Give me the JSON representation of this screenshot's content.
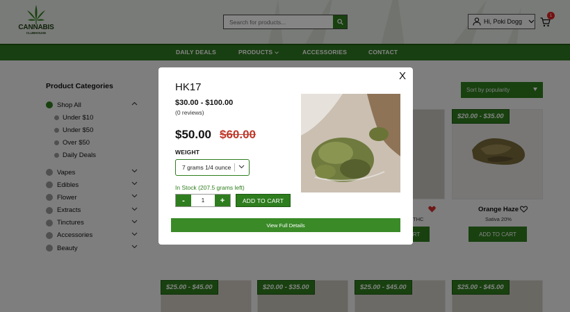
{
  "header": {
    "logo_line1": "CANNABIS",
    "logo_line2": "CLUBHOUSE",
    "search_placeholder": "Search for products...",
    "account_label": "Hi, Poki Dogg",
    "cart_count": "1"
  },
  "nav": {
    "items": [
      "DAILY DEALS",
      "PRODUCTS",
      "ACCESSORIES",
      "CONTACT"
    ]
  },
  "sidebar": {
    "title": "Product Categories",
    "categories": [
      {
        "label": "Shop All"
      },
      {
        "label": "Under $10"
      },
      {
        "label": "Under $50"
      },
      {
        "label": "Over $50"
      },
      {
        "label": "Daily Deals"
      },
      {
        "label": "Vapes"
      },
      {
        "label": "Edibles"
      },
      {
        "label": "Flower"
      },
      {
        "label": "Extracts"
      },
      {
        "label": "Tinctures"
      },
      {
        "label": "Accessories"
      },
      {
        "label": "Beauty"
      }
    ]
  },
  "sort": {
    "label": "Sort by popularity"
  },
  "products": [
    {
      "price": "$20.00 - $35.00",
      "name": "Orange Haze",
      "sub": "Sativa 20%",
      "cta": "ADD TO CART"
    },
    {
      "name_partial": "op",
      "sub_partial": "THC",
      "cta_partial": "RT"
    }
  ],
  "bottom_prices": [
    "$25.00 - $45.00",
    "$20.00 - $35.00",
    "$25.00 - $45.00",
    "$25.00 - $45.00"
  ],
  "modal": {
    "title": "HK17",
    "price_range": "$30.00 - $100.00",
    "reviews": "(0 reviews)",
    "price": "$50.00",
    "old_price": "$60.00",
    "weight_label": "WEIGHT",
    "weight_selected": "7 grams 1/4 ounce",
    "stock": "In Stock (207.5 grams left)",
    "qty_minus": "-",
    "qty_value": "1",
    "qty_plus": "+",
    "add_to_cart": "ADD TO CART",
    "view_details": "View Full Details",
    "close": "X"
  },
  "colors": {
    "brand_green": "#2e7d1e",
    "sale_red": "#c0392b",
    "badge_red": "#dd2222"
  }
}
